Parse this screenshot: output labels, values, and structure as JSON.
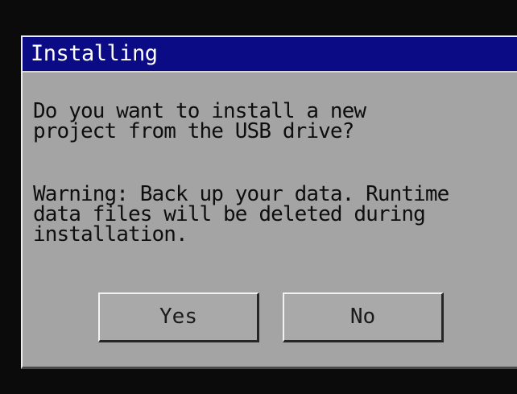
{
  "dialog": {
    "title": "Installing",
    "message": {
      "line1": "Do you want to install a new",
      "line2": "project from the USB drive?"
    },
    "warning": {
      "line1": "Warning: Back up your data. Runtime",
      "line2": "data files will be deleted during",
      "line3": "installation."
    },
    "buttons": {
      "yes": "Yes",
      "no": "No"
    }
  },
  "colors": {
    "title_bar": "#0b0b85",
    "dialog_body": "#a4a4a4",
    "screen_background": "#0b0b0b"
  }
}
